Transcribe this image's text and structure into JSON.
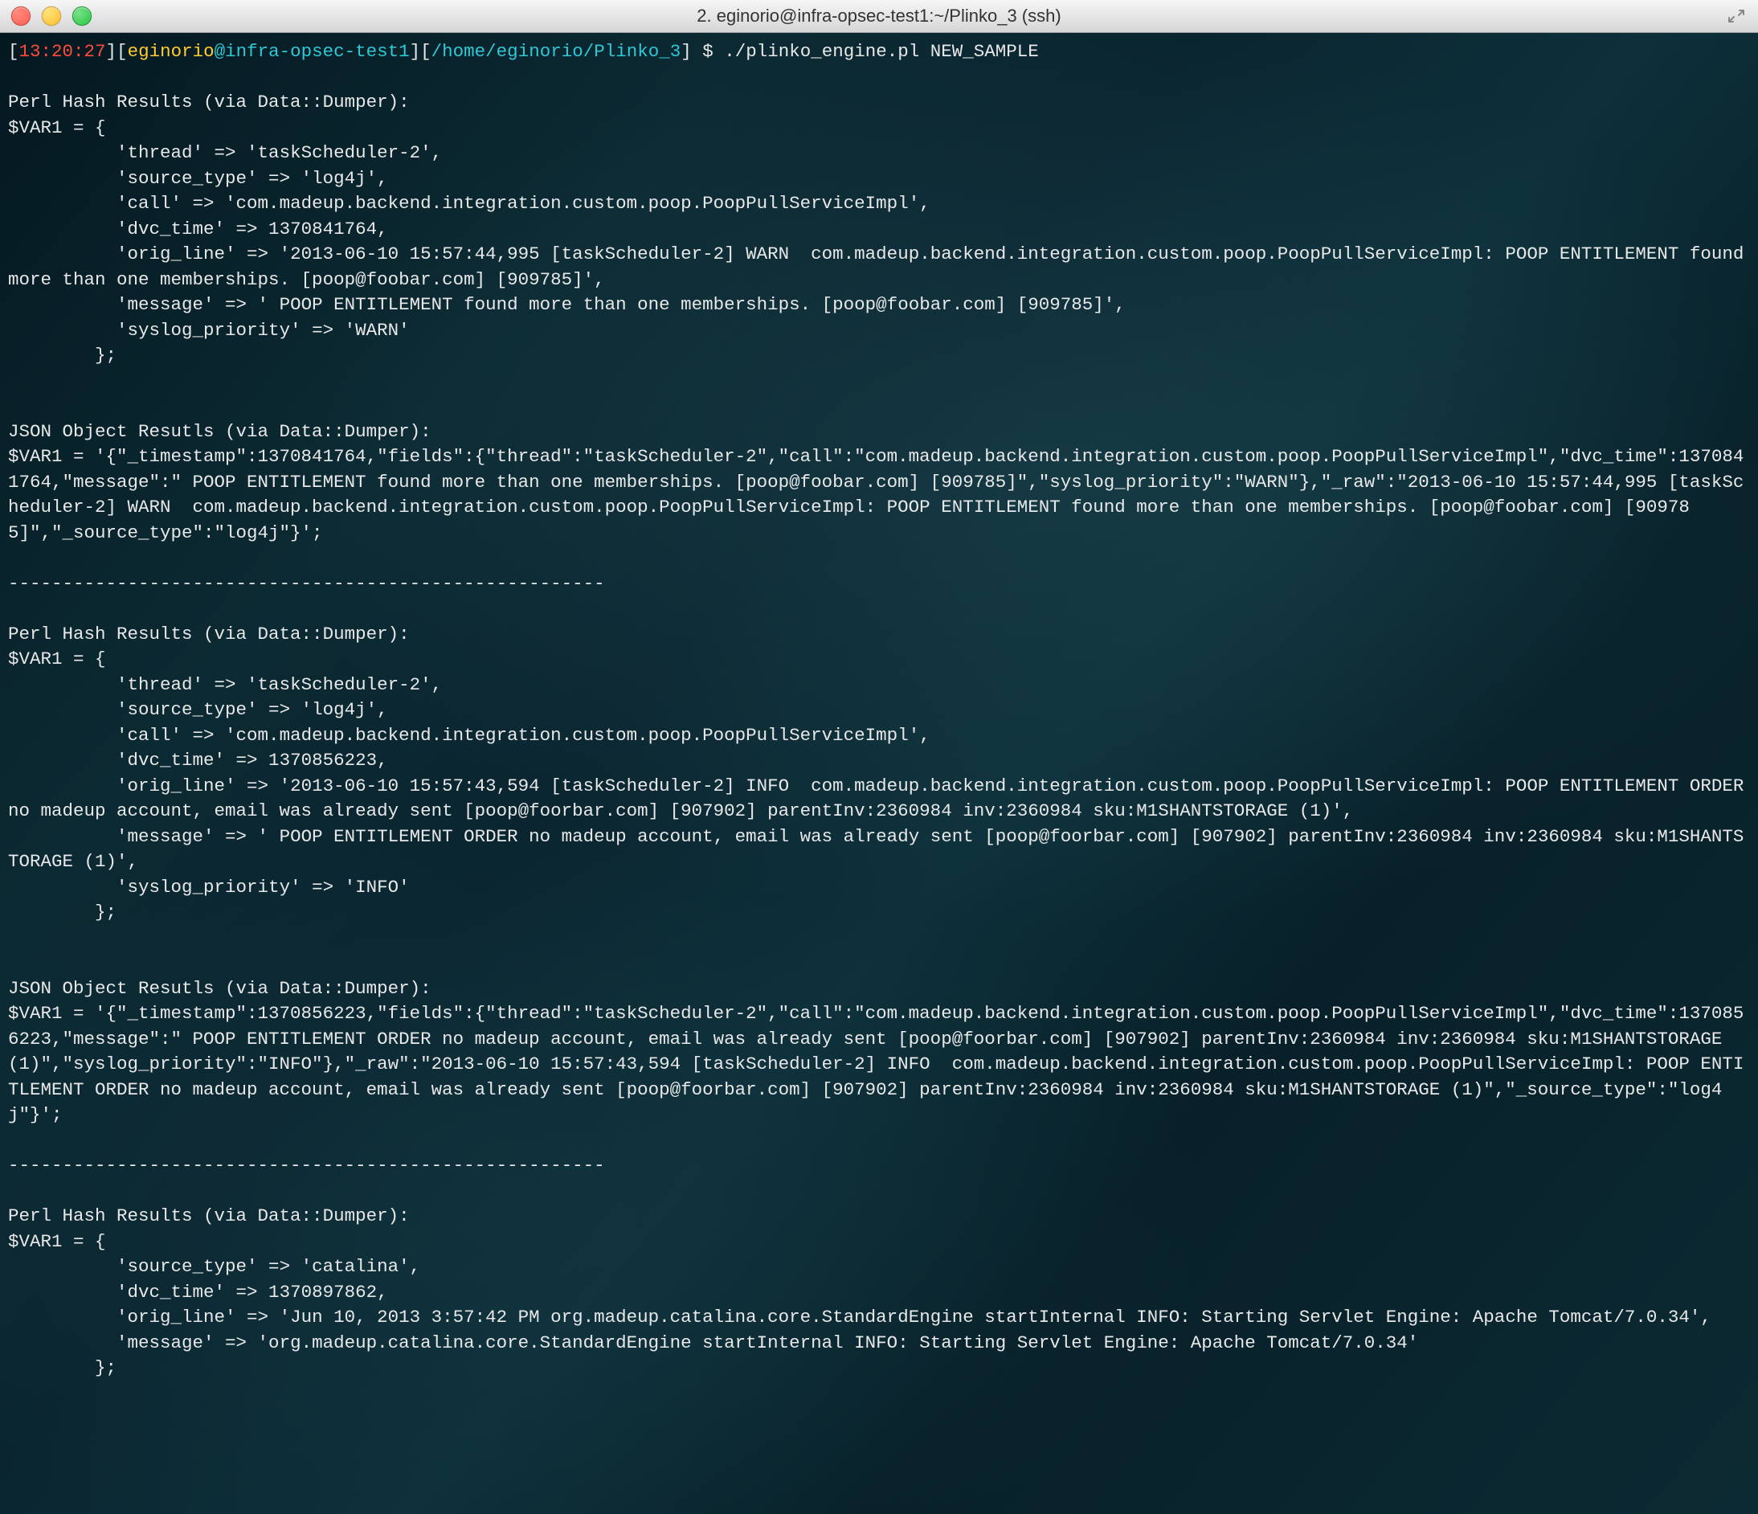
{
  "window": {
    "title": "2. eginorio@infra-opsec-test1:~/Plinko_3 (ssh)"
  },
  "prompt": {
    "lb1": "[",
    "time": "13:20:27",
    "rb1": "][",
    "user": "eginorio",
    "at": "@",
    "host": "infra-opsec-test1",
    "rb2": "][",
    "path": "/home/eginorio/Plinko_3",
    "rb3": "] $ ",
    "cmd": "./plinko_engine.pl NEW_SAMPLE"
  },
  "body": "\n\nPerl Hash Results (via Data::Dumper):\n$VAR1 = {\n          'thread' => 'taskScheduler-2',\n          'source_type' => 'log4j',\n          'call' => 'com.madeup.backend.integration.custom.poop.PoopPullServiceImpl',\n          'dvc_time' => 1370841764,\n          'orig_line' => '2013-06-10 15:57:44,995 [taskScheduler-2] WARN  com.madeup.backend.integration.custom.poop.PoopPullServiceImpl: POOP ENTITLEMENT found more than one memberships. [poop@foobar.com] [909785]',\n          'message' => ' POOP ENTITLEMENT found more than one memberships. [poop@foobar.com] [909785]',\n          'syslog_priority' => 'WARN'\n        };\n\n\nJSON Object Resutls (via Data::Dumper):\n$VAR1 = '{\"_timestamp\":1370841764,\"fields\":{\"thread\":\"taskScheduler-2\",\"call\":\"com.madeup.backend.integration.custom.poop.PoopPullServiceImpl\",\"dvc_time\":1370841764,\"message\":\" POOP ENTITLEMENT found more than one memberships. [poop@foobar.com] [909785]\",\"syslog_priority\":\"WARN\"},\"_raw\":\"2013-06-10 15:57:44,995 [taskScheduler-2] WARN  com.madeup.backend.integration.custom.poop.PoopPullServiceImpl: POOP ENTITLEMENT found more than one memberships. [poop@foobar.com] [909785]\",\"_source_type\":\"log4j\"}';\n\n-------------------------------------------------------\n\nPerl Hash Results (via Data::Dumper):\n$VAR1 = {\n          'thread' => 'taskScheduler-2',\n          'source_type' => 'log4j',\n          'call' => 'com.madeup.backend.integration.custom.poop.PoopPullServiceImpl',\n          'dvc_time' => 1370856223,\n          'orig_line' => '2013-06-10 15:57:43,594 [taskScheduler-2] INFO  com.madeup.backend.integration.custom.poop.PoopPullServiceImpl: POOP ENTITLEMENT ORDER no madeup account, email was already sent [poop@foorbar.com] [907902] parentInv:2360984 inv:2360984 sku:M1SHANTSTORAGE (1)',\n          'message' => ' POOP ENTITLEMENT ORDER no madeup account, email was already sent [poop@foorbar.com] [907902] parentInv:2360984 inv:2360984 sku:M1SHANTSTORAGE (1)',\n          'syslog_priority' => 'INFO'\n        };\n\n\nJSON Object Resutls (via Data::Dumper):\n$VAR1 = '{\"_timestamp\":1370856223,\"fields\":{\"thread\":\"taskScheduler-2\",\"call\":\"com.madeup.backend.integration.custom.poop.PoopPullServiceImpl\",\"dvc_time\":1370856223,\"message\":\" POOP ENTITLEMENT ORDER no madeup account, email was already sent [poop@foorbar.com] [907902] parentInv:2360984 inv:2360984 sku:M1SHANTSTORAGE (1)\",\"syslog_priority\":\"INFO\"},\"_raw\":\"2013-06-10 15:57:43,594 [taskScheduler-2] INFO  com.madeup.backend.integration.custom.poop.PoopPullServiceImpl: POOP ENTITLEMENT ORDER no madeup account, email was already sent [poop@foorbar.com] [907902] parentInv:2360984 inv:2360984 sku:M1SHANTSTORAGE (1)\",\"_source_type\":\"log4j\"}';\n\n-------------------------------------------------------\n\nPerl Hash Results (via Data::Dumper):\n$VAR1 = {\n          'source_type' => 'catalina',\n          'dvc_time' => 1370897862,\n          'orig_line' => 'Jun 10, 2013 3:57:42 PM org.madeup.catalina.core.StandardEngine startInternal INFO: Starting Servlet Engine: Apache Tomcat/7.0.34',\n          'message' => 'org.madeup.catalina.core.StandardEngine startInternal INFO: Starting Servlet Engine: Apache Tomcat/7.0.34'\n        };"
}
